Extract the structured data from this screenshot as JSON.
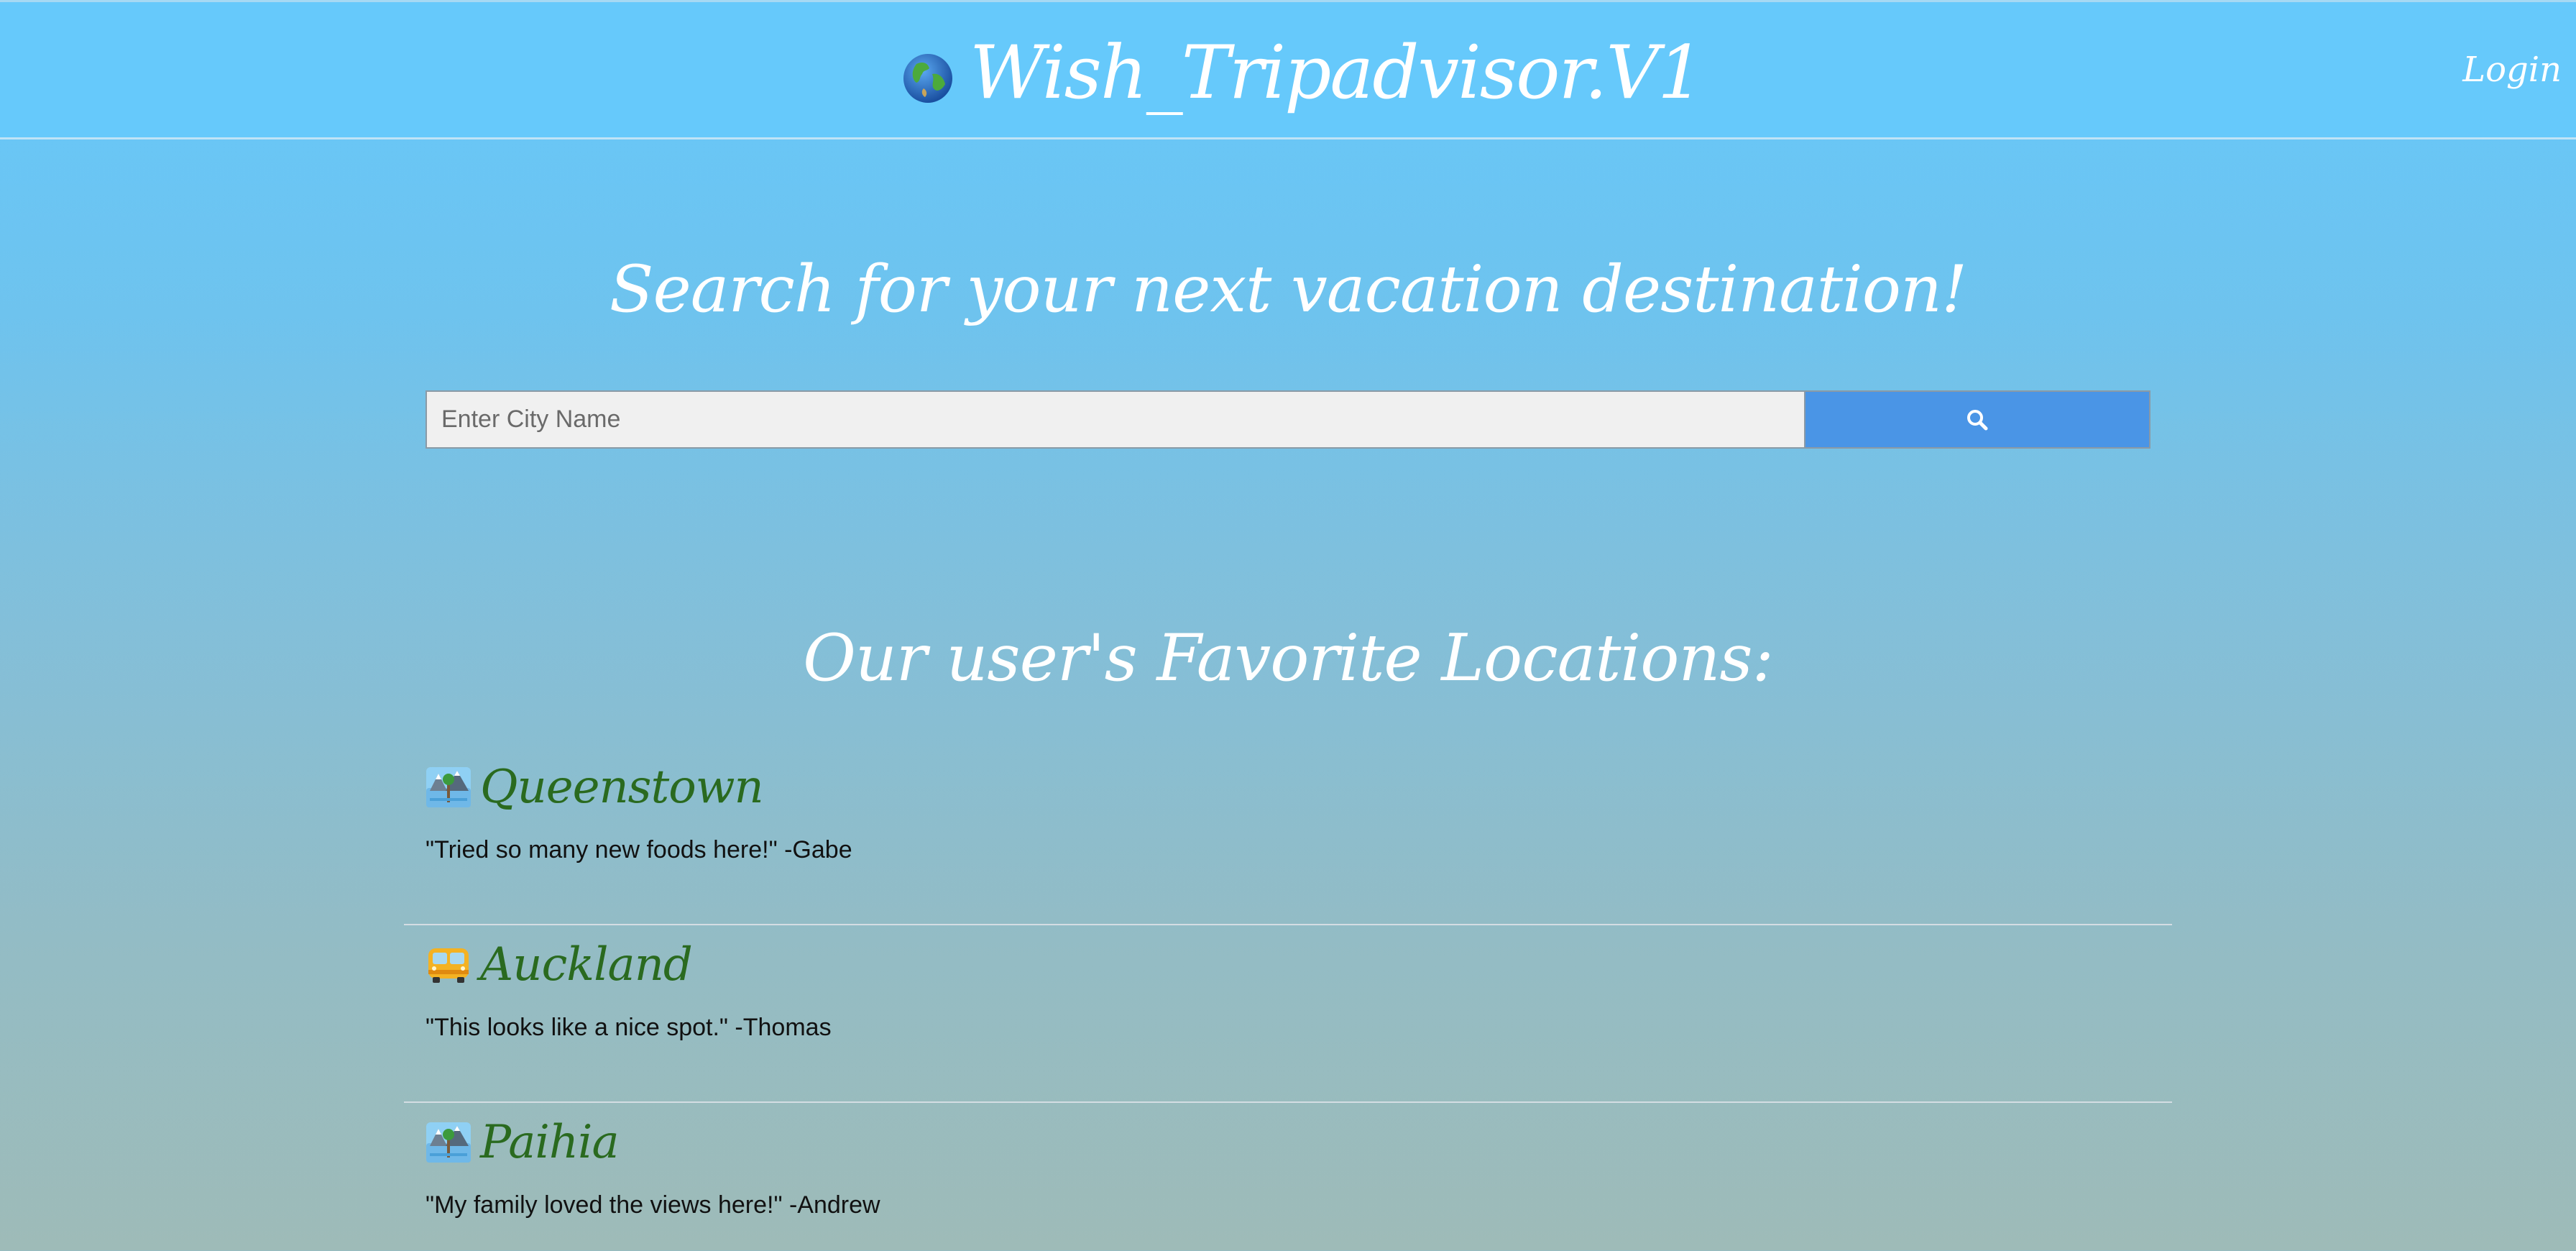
{
  "header": {
    "globe_icon": "globe-icon",
    "title": "Wish_Tripadvisor.V1",
    "login_label": "Login"
  },
  "hero": {
    "title": "Search for your next vacation destination!"
  },
  "search": {
    "placeholder": "Enter City Name",
    "value": "",
    "button_icon": "search-icon",
    "button_color": "#4a95e6"
  },
  "favorites": {
    "title": "Our user's Favorite Locations:",
    "items": [
      {
        "icon": "national-park-icon",
        "name": "Queenstown",
        "quote": "\"Tried so many new foods here!\" -Gabe"
      },
      {
        "icon": "bus-icon",
        "name": "Auckland",
        "quote": "\"This looks like a nice spot.\" -Thomas"
      },
      {
        "icon": "national-park-icon",
        "name": "Paihia",
        "quote": "\"My family loved the views here!\" -Andrew"
      }
    ]
  },
  "colors": {
    "header_bg": "#66c9fb",
    "location_name": "#2a6a1f"
  }
}
